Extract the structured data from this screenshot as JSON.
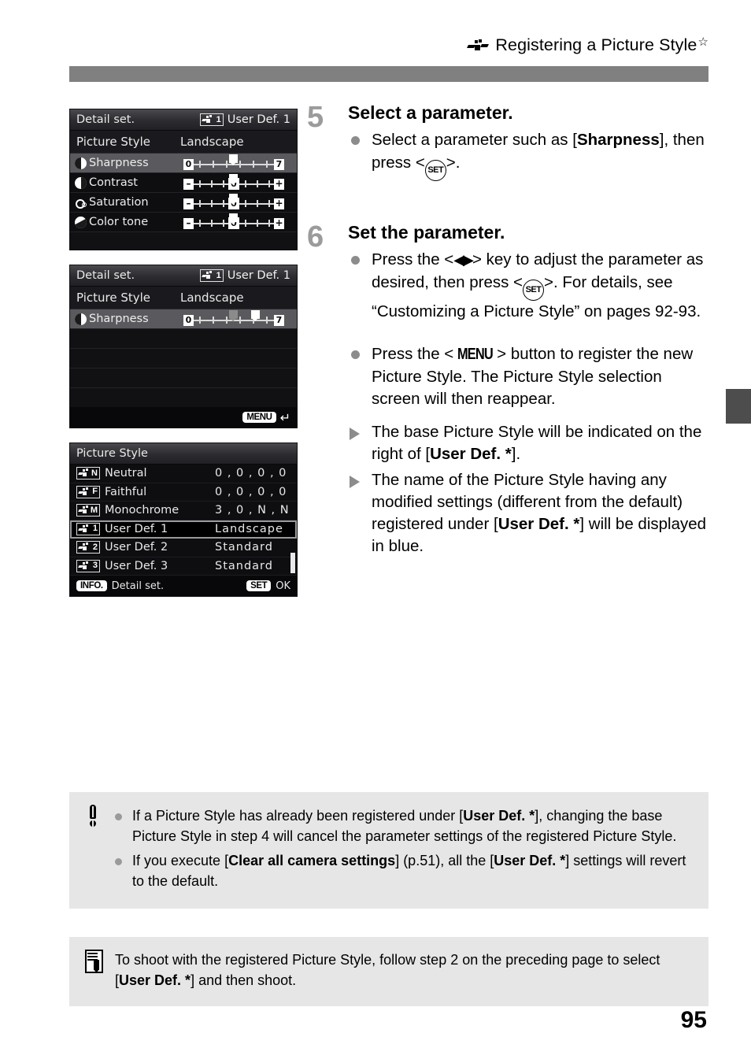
{
  "header": {
    "title": "Registering a Picture Style",
    "star": "☆",
    "icon": "picture-style-icon"
  },
  "page_number": "95",
  "screens": [
    {
      "id": "detail-set-all-params",
      "titlebar": {
        "left": "Detail set.",
        "badge_letter": "1",
        "right": "User Def. 1"
      },
      "subrow": {
        "label": "Picture Style",
        "value": "Landscape"
      },
      "rows": [
        {
          "label": "Sharpness",
          "glyph": "sharpness-icon",
          "selected": true,
          "slider": {
            "kind": "zero-seven",
            "left_label": "0",
            "right_label": "7",
            "pointer_pct": 50
          }
        },
        {
          "label": "Contrast",
          "glyph": "contrast-icon",
          "selected": false,
          "slider": {
            "kind": "plus-minus",
            "left_label": "–",
            "right_label": "+",
            "center_label": "0",
            "pointer_pct": 50
          }
        },
        {
          "label": "Saturation",
          "glyph": "saturation-icon",
          "selected": false,
          "slider": {
            "kind": "plus-minus",
            "left_label": "–",
            "right_label": "+",
            "center_label": "0",
            "pointer_pct": 50
          }
        },
        {
          "label": "Color tone",
          "glyph": "color-tone-icon",
          "selected": false,
          "slider": {
            "kind": "plus-minus",
            "left_label": "–",
            "right_label": "+",
            "center_label": "0",
            "pointer_pct": 50
          }
        }
      ]
    },
    {
      "id": "detail-set-sharpness",
      "titlebar": {
        "left": "Detail set.",
        "badge_letter": "1",
        "right": "User Def. 1"
      },
      "subrow": {
        "label": "Picture Style",
        "value": "Landscape"
      },
      "rows": [
        {
          "label": "Sharpness",
          "glyph": "sharpness-icon",
          "selected": true,
          "slider": {
            "kind": "zero-seven",
            "left_label": "0",
            "right_label": "7",
            "old_pointer_pct": 50,
            "pointer_pct": 71
          }
        }
      ],
      "footer": {
        "menu_badge": "MENU",
        "return_glyph": "↵"
      }
    },
    {
      "id": "picture-style-list",
      "titlebar": {
        "left": "Picture Style"
      },
      "items": [
        {
          "badge": "N",
          "name": "Neutral",
          "value": "0 , 0 , 0 , 0",
          "selected": false
        },
        {
          "badge": "F",
          "name": "Faithful",
          "value": "0 , 0 , 0 , 0",
          "selected": false
        },
        {
          "badge": "M",
          "name": "Monochrome",
          "value": "3 , 0 , N , N",
          "selected": false
        },
        {
          "badge": "1",
          "name": "User Def. 1",
          "value": "Landscape",
          "selected": true
        },
        {
          "badge": "2",
          "name": "User Def. 2",
          "value": "Standard",
          "selected": false
        },
        {
          "badge": "3",
          "name": "User Def. 3",
          "value": "Standard",
          "selected": false
        }
      ],
      "footer": {
        "info_badge": "INFO.",
        "info_label": "Detail set.",
        "set_badge": "SET",
        "set_label": "OK"
      }
    }
  ],
  "steps": [
    {
      "number": "5",
      "heading": "Select a parameter.",
      "bullet_1_part1": "Select a parameter such as [",
      "bullet_1_bold": "Sharpness",
      "bullet_1_part2": "], then press <",
      "bullet_1_key": "SET",
      "bullet_1_part3": ">."
    },
    {
      "number": "6",
      "heading": "Set the parameter.",
      "bullet_1_part1": "Press the <",
      "bullet_1_arrows": "◀▶",
      "bullet_1_part2": "> key to adjust the parameter as desired, then press <",
      "bullet_1_key": "SET",
      "bullet_1_part3": ">. For details, see “Customizing a Picture Style” on pages 92-93.",
      "bullet_2_part1": "Press the <",
      "bullet_2_key": "MENU",
      "bullet_2_part2": "> button to register the new Picture Style. The Picture Style selection screen will then reappear.",
      "arrow_1_part1": "The base Picture Style will be indicated on the right of [",
      "arrow_1_bold": "User Def. *",
      "arrow_1_part2": "].",
      "arrow_2_part1": "The name of the Picture Style having any modified settings (different from the default) registered under [",
      "arrow_2_bold": "User Def. *",
      "arrow_2_part2": "] will be displayed in blue."
    }
  ],
  "caution": {
    "icon": "caution-icon",
    "bullets": [
      {
        "p1": "If a Picture Style has already been registered under [",
        "b1": "User Def. *",
        "p2": "], changing the base Picture Style in step 4 will cancel the parameter settings of the registered Picture Style."
      },
      {
        "p1": "If you execute [",
        "b1": "Clear all camera settings",
        "p2": "] (p.51), all the [",
        "b2": "User Def. *",
        "p3": "] settings will revert to the default."
      }
    ]
  },
  "tip": {
    "icon": "note-icon",
    "p1": "To shoot with the registered Picture Style, follow step 2 on the preceding page to select [",
    "b1": "User Def. *",
    "p2": "] and then shoot."
  }
}
